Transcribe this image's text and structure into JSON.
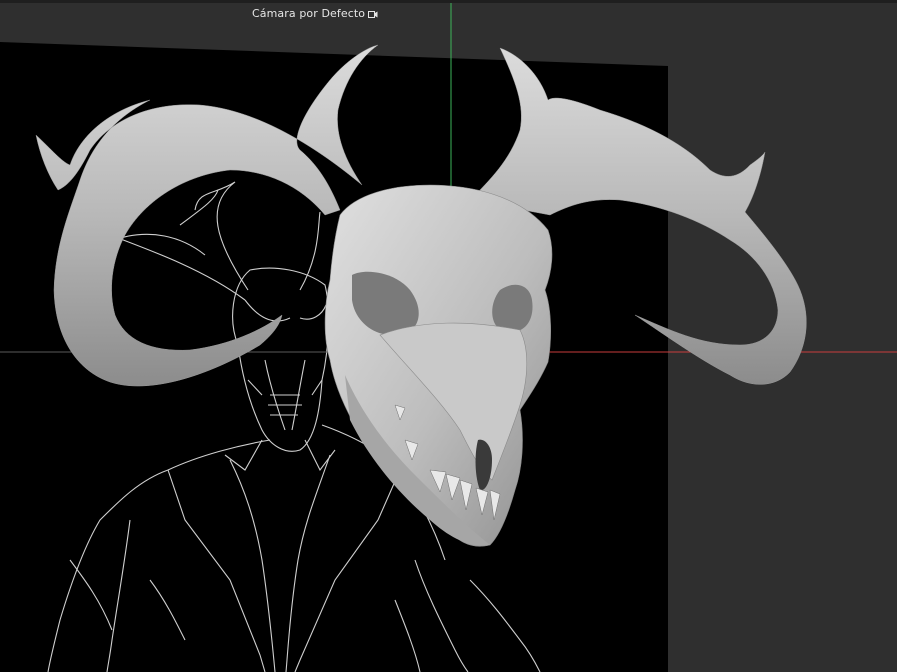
{
  "viewport": {
    "camera_label": "Cámara por Defecto",
    "camera_icon": "camera-icon",
    "colors": {
      "background": "#2f2f2f",
      "reference_plane": "#000000",
      "axis_x": "#c83c3c",
      "axis_y": "#3cb45a",
      "sketch_lines": "#cfcfcf",
      "mesh": "#b5b5b5"
    }
  }
}
